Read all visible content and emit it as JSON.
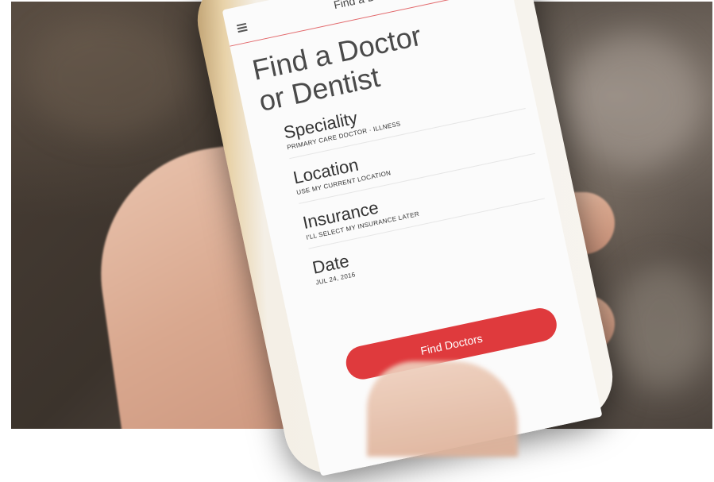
{
  "app": {
    "nav_title": "Find a Doctor",
    "heading_line1": "Find a Doctor",
    "heading_line2": "or Dentist"
  },
  "fields": [
    {
      "label": "Speciality",
      "value": "PRIMARY CARE DOCTOR  ·  ILLNESS"
    },
    {
      "label": "Location",
      "value": "USE MY CURRENT LOCATION"
    },
    {
      "label": "Insurance",
      "value": "I'LL SELECT MY INSURANCE LATER"
    },
    {
      "label": "Date",
      "value": "JUL 24, 2016"
    }
  ],
  "button": {
    "label": "Find Doctors"
  },
  "colors": {
    "accent": "#df3a3d",
    "nav_underline": "#e2686b"
  },
  "icons": {
    "menu": "menu-icon"
  }
}
